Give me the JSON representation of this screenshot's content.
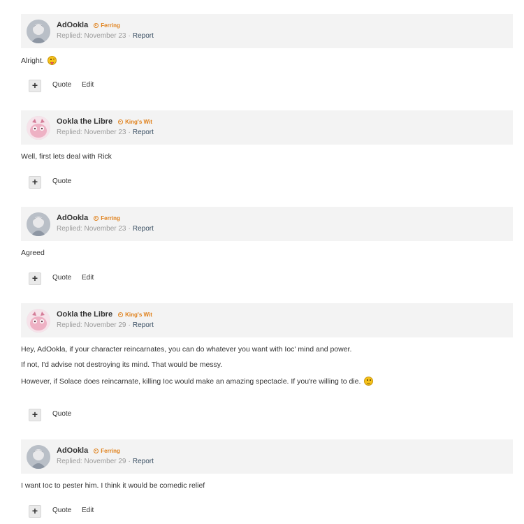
{
  "actions": {
    "quote": "Quote",
    "edit": "Edit",
    "plus": "+"
  },
  "posts": [
    {
      "author": "AdOokla",
      "rank": "Ferring",
      "replied": "Replied: November 23",
      "separator": "·",
      "report": "Report",
      "avatar_icon": "avatar-helmet-icon",
      "lines": [
        "Alright."
      ],
      "line_emoji": "tongue-emoji-icon",
      "has_edit": true
    },
    {
      "author": "Ookla the Libre",
      "rank": "King's Wit",
      "replied": "Replied: November 23",
      "separator": "·",
      "report": "Report",
      "avatar_icon": "avatar-pink-owl-icon",
      "lines": [
        "Well, first lets deal with Rick"
      ],
      "has_edit": false
    },
    {
      "author": "AdOokla",
      "rank": "Ferring",
      "replied": "Replied: November 23",
      "separator": "·",
      "report": "Report",
      "avatar_icon": "avatar-helmet-icon",
      "lines": [
        "Agreed"
      ],
      "has_edit": true
    },
    {
      "author": "Ookla the Libre",
      "rank": "King's Wit",
      "replied": "Replied: November 29",
      "separator": "·",
      "report": "Report",
      "avatar_icon": "avatar-pink-owl-icon",
      "lines": [
        "Hey, AdOokla, if your character reincarnates, you can do whatever you want with Ioc' mind and power.",
        "If not, I'd advise not destroying its mind. That would be messy.",
        "However, if Solace does reincarnate, killing Ioc would make an amazing spectacle. If you're willing to die."
      ],
      "line_emoji": "smile-emoji-icon",
      "has_edit": false
    },
    {
      "author": "AdOokla",
      "rank": "Ferring",
      "replied": "Replied: November 29",
      "separator": "·",
      "report": "Report",
      "avatar_icon": "avatar-helmet-icon",
      "lines": [
        "I want Ioc to pester him. I think it would be comedic relief"
      ],
      "has_edit": true
    }
  ]
}
